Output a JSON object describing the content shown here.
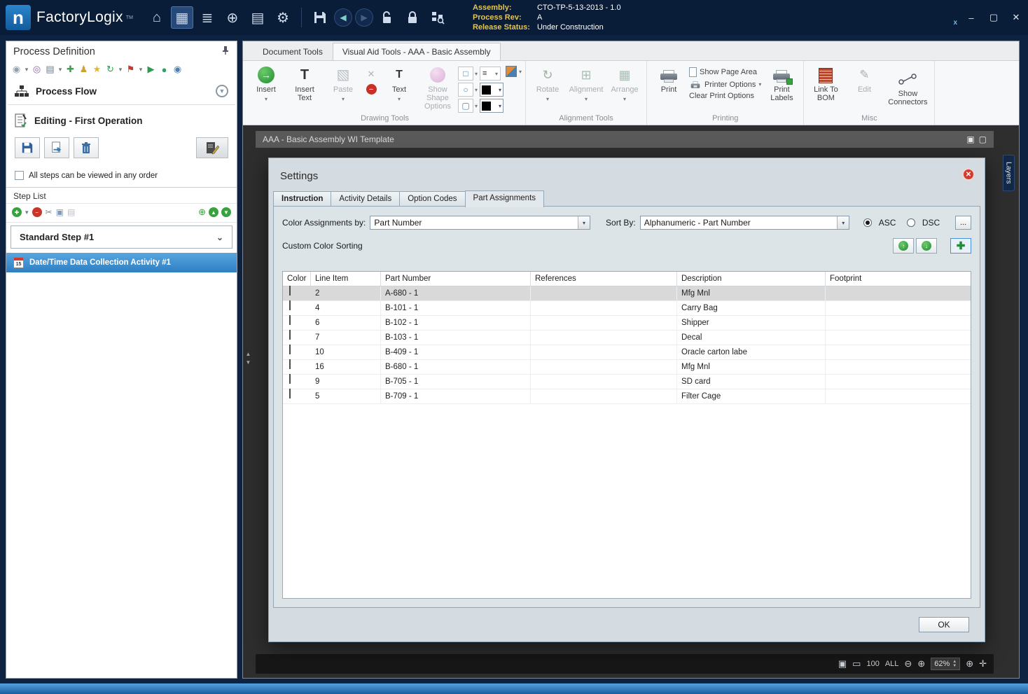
{
  "titlebar": {
    "logo_letter": "n",
    "app_name": "FactoryLogix",
    "tm": "TM",
    "assembly_label": "Assembly:",
    "assembly_value": "CTO-TP-5-13-2013 - 1.0",
    "process_rev_label": "Process Rev:",
    "process_rev_value": "A",
    "release_status_label": "Release Status:",
    "release_status_value": "Under Construction",
    "window_controls": {
      "minimize": "–",
      "maximize": "▢",
      "close": "✕"
    }
  },
  "icons": {
    "home": "⌂",
    "process_grid": "▦",
    "stack": "≣",
    "navigate": "⊕",
    "pages": "▤",
    "gear": "⚙",
    "back": "◀",
    "forward": "▶",
    "dropdown": "▾",
    "chevron_down": "⌄",
    "pencil": "✎",
    "scissors": "✂",
    "copy": "▣",
    "paste_page": "▤",
    "plus": "✚",
    "minus": "−",
    "up_arrow": "↑",
    "down_arrow": "↓",
    "up_tri": "▲",
    "down_tri": "▼",
    "zoom": "⊕",
    "rotate": "↻",
    "alignment": "⊞",
    "arrange": "▦",
    "x": "✕",
    "insert_arrow": "→",
    "letter_t": "T",
    "paste_clipboard": "▧",
    "square": "□",
    "circle": "○",
    "rounded": "▢",
    "lines": "≡",
    "user_x": "x",
    "doc1": "▣",
    "doc2": "▢"
  },
  "sidebar": {
    "title": "Process Definition",
    "tool_icons": [
      {
        "name": "sphere-icon",
        "glyph": "◉"
      },
      {
        "name": "dropdown-arrow-icon",
        "glyph": "▾"
      },
      {
        "name": "attachment-icon",
        "glyph": "◎"
      },
      {
        "name": "printer-icon",
        "glyph": "▤"
      },
      {
        "name": "dropdown-arrow-icon",
        "glyph": "▾"
      },
      {
        "name": "tools-icon",
        "glyph": "✚"
      },
      {
        "name": "user-icon",
        "glyph": "♟"
      },
      {
        "name": "user-star-icon",
        "glyph": "★"
      },
      {
        "name": "sync-icon",
        "glyph": "↻"
      },
      {
        "name": "dropdown-arrow-icon",
        "glyph": "▾"
      },
      {
        "name": "flag-icon",
        "glyph": "⚑"
      },
      {
        "name": "dropdown-arrow-icon",
        "glyph": "▾"
      },
      {
        "name": "start-icon",
        "glyph": "▶"
      },
      {
        "name": "record-icon",
        "glyph": "●"
      },
      {
        "name": "info-icon",
        "glyph": "◉"
      }
    ],
    "process_flow_label": "Process Flow",
    "editing_label": "Editing - First Operation",
    "order_checkbox_label": "All steps can be viewed in any order",
    "step_list_title": "Step List",
    "step_name": "Standard Step #1",
    "activity_name": "Date/Time Data Collection Activity #1",
    "activity_calendar_day": "15"
  },
  "ribbon": {
    "tabs": [
      {
        "label": "Document Tools"
      },
      {
        "label": "Visual Aid Tools - AAA - Basic Assembly"
      }
    ],
    "drawing": {
      "insert": "Insert",
      "insert_text": "Insert Text",
      "paste": "Paste",
      "text": "Text",
      "show_shape_options": "Show Shape Options",
      "group_label": "Drawing Tools"
    },
    "alignment": {
      "rotate": "Rotate",
      "alignment": "Alignment",
      "arrange": "Arrange",
      "group_label": "Alignment Tools"
    },
    "printing": {
      "print": "Print",
      "show_page_area": "Show Page Area",
      "printer_options": "Printer Options",
      "clear_print_options": "Clear Print Options",
      "print_labels": "Print Labels",
      "group_label": "Printing"
    },
    "misc": {
      "link_to_bom": "Link To BOM",
      "edit": "Edit",
      "show_connectors": "Show Connectors",
      "group_label": "Misc"
    }
  },
  "document": {
    "title": "AAA - Basic Assembly WI Template"
  },
  "layers_tab_label": "Layers",
  "dialog": {
    "title": "Settings",
    "close_glyph": "✕",
    "tabs": [
      {
        "label": "Instruction"
      },
      {
        "label": "Activity Details"
      },
      {
        "label": "Option Codes"
      },
      {
        "label": "Part Assignments"
      }
    ],
    "color_assignments_label": "Color Assignments by:",
    "color_assignments_value": "Part Number",
    "sort_by_label": "Sort By:",
    "sort_by_value": "Alphanumeric - Part Number",
    "asc_label": "ASC",
    "dsc_label": "DSC",
    "sort_direction": "ASC",
    "more_button": "...",
    "custom_color_sorting_label": "Custom Color Sorting",
    "table": {
      "columns": [
        "Color",
        "Line Item",
        "Part Number",
        "References",
        "Description",
        "Footprint"
      ],
      "rows": [
        {
          "color": "#1caa50",
          "line_item": "2",
          "part_number": "A-680 - 1",
          "references": "",
          "description": "Mfg Mnl",
          "footprint": "",
          "selected": true
        },
        {
          "color": "#199ee0",
          "line_item": "4",
          "part_number": "B-101 - 1",
          "references": "",
          "description": "Carry Bag",
          "footprint": "",
          "selected": false
        },
        {
          "color": "#e9137e",
          "line_item": "6",
          "part_number": "B-102 - 1",
          "references": "",
          "description": "Shipper",
          "footprint": "",
          "selected": false
        },
        {
          "color": "#f58a62",
          "line_item": "7",
          "part_number": "B-103 - 1",
          "references": "",
          "description": "Decal",
          "footprint": "",
          "selected": false
        },
        {
          "color": "#23a55b",
          "line_item": "10",
          "part_number": "B-409 - 1",
          "references": "",
          "description": "Oracle carton labe",
          "footprint": "",
          "selected": false
        },
        {
          "color": "#15a79a",
          "line_item": "16",
          "part_number": "B-680 - 1",
          "references": "",
          "description": "Mfg Mnl",
          "footprint": "",
          "selected": false
        },
        {
          "color": "#f398c6",
          "line_item": "9",
          "part_number": "B-705 - 1",
          "references": "",
          "description": "SD card",
          "footprint": "",
          "selected": false
        },
        {
          "color": "#f57616",
          "line_item": "5",
          "part_number": "B-709 - 1",
          "references": "",
          "description": "Filter Cage",
          "footprint": "",
          "selected": false
        }
      ]
    },
    "ok_label": "OK"
  },
  "zoombar": {
    "fit_page": "▣",
    "fit_width": "▭",
    "hundred": "100",
    "all": "ALL",
    "zoom_out": "⊖",
    "zoom_in": "⊕",
    "zoom_percent": "62%",
    "zoom_sel": "⊕",
    "pan": "✛"
  }
}
